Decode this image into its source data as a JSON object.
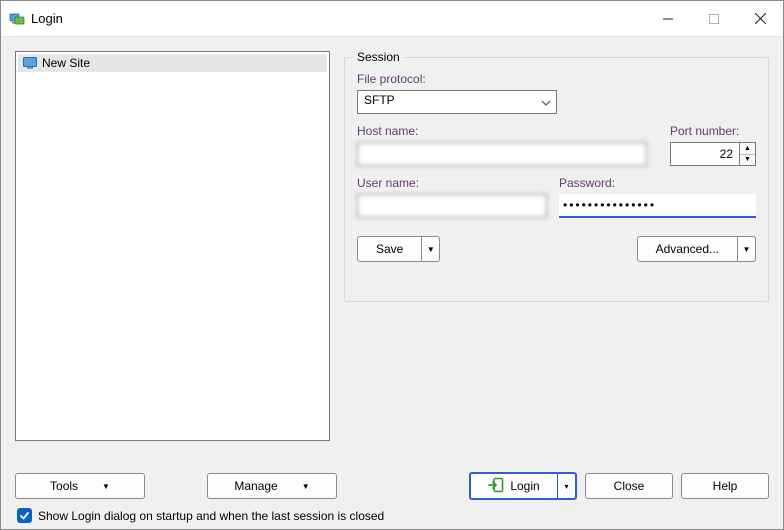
{
  "window": {
    "title": "Login"
  },
  "sites": {
    "items": [
      {
        "label": "New Site"
      }
    ]
  },
  "session": {
    "legend": "Session",
    "protocol_label": "File protocol:",
    "protocol_value": "SFTP",
    "host_label": "Host name:",
    "host_value": "",
    "port_label": "Port number:",
    "port_value": "22",
    "user_label": "User name:",
    "user_value": "",
    "password_label": "Password:",
    "password_value": "•••••••••••••••",
    "save_label": "Save",
    "advanced_label": "Advanced..."
  },
  "bottom": {
    "tools_label": "Tools",
    "manage_label": "Manage",
    "login_label": "Login",
    "close_label": "Close",
    "help_label": "Help"
  },
  "checkbox": {
    "checked": true,
    "label": "Show Login dialog on startup and when the last session is closed"
  }
}
